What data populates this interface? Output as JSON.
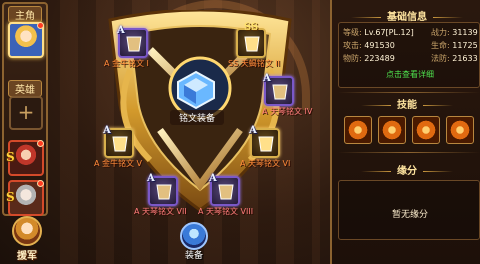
{
  "left": {
    "main_tab": "主角",
    "hero_tab": "英雄",
    "rank": "S",
    "army_label": "援军"
  },
  "shield": {
    "center_label": "铭文装备",
    "equip_label": "装备",
    "slots": [
      {
        "grade": "A",
        "label": "A 金牛铭文 I"
      },
      {
        "grade": "SS",
        "label": "SS 天蝎铭文 II"
      },
      {
        "grade": "A",
        "label": "A 天琴铭文 IV"
      },
      {
        "grade": "A",
        "label": "A 金牛铭文 V"
      },
      {
        "grade": "A",
        "label": "A 天琴铭文 VI"
      },
      {
        "grade": "A",
        "label": "A 天琴铭文 VII"
      },
      {
        "grade": "A",
        "label": "A 天琴铭文 VIII"
      }
    ]
  },
  "panel": {
    "basic_title": "基础信息",
    "stats": {
      "level_k": "等级:",
      "level_v": "Lv.67[PL.12]",
      "power_k": "战力:",
      "power_v": "31139",
      "attack_k": "攻击:",
      "attack_v": "491530",
      "hp_k": "生命:",
      "hp_v": "11725",
      "pdef_k": "物防:",
      "pdef_v": "223489",
      "mdef_k": "法防:",
      "mdef_v": "21633"
    },
    "detail_link": "点击查看详细",
    "skills_title": "技能",
    "fate_title": "缘分",
    "fate_text": "暂无缘分"
  }
}
